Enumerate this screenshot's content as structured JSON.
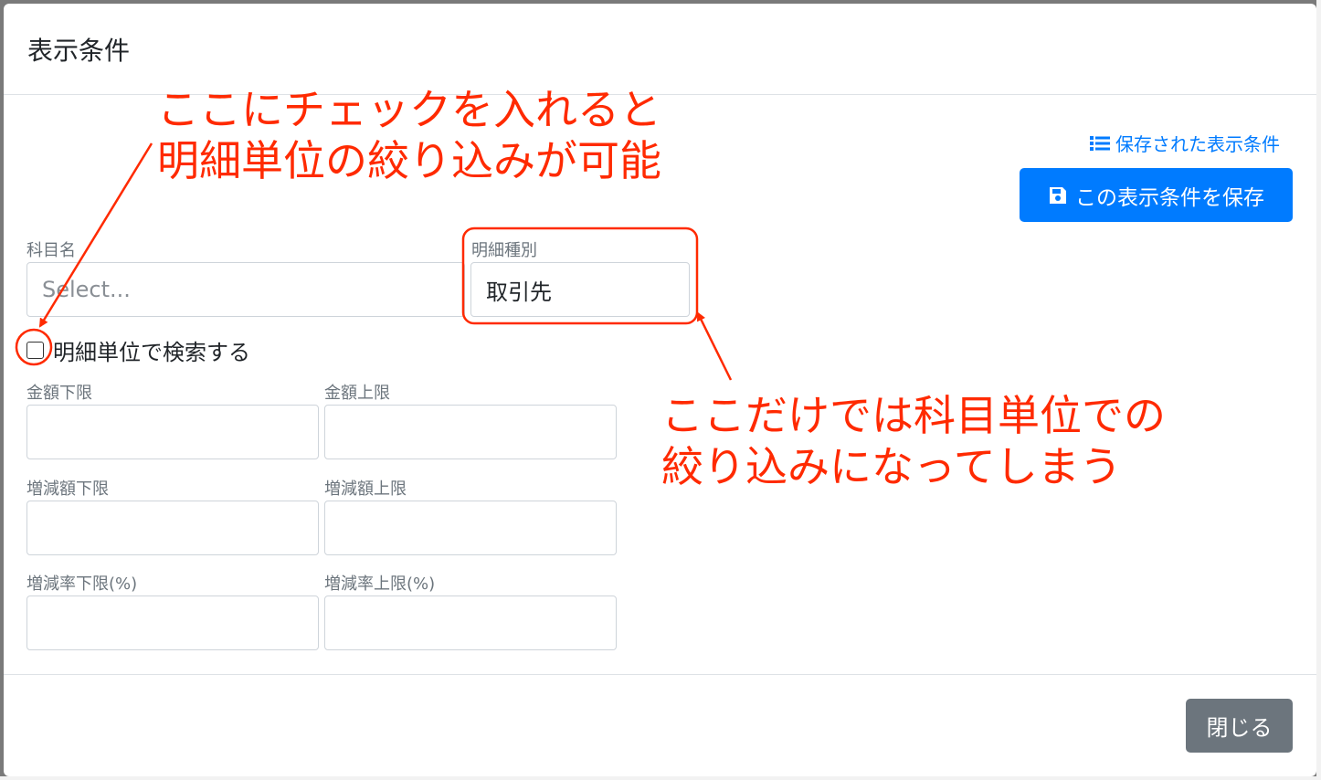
{
  "modal": {
    "title": "表示条件",
    "saved_conditions_link": "保存された表示条件",
    "save_button": "この表示条件を保存",
    "close_button": "閉じる"
  },
  "form": {
    "account_name": {
      "label": "科目名",
      "placeholder": "Select..."
    },
    "detail_type": {
      "label": "明細種別",
      "value": "取引先"
    },
    "detail_search_checkbox": {
      "label": "明細単位で検索する",
      "checked": false
    },
    "amount_min": {
      "label": "金額下限",
      "value": ""
    },
    "amount_max": {
      "label": "金額上限",
      "value": ""
    },
    "change_amount_min": {
      "label": "増減額下限",
      "value": ""
    },
    "change_amount_max": {
      "label": "増減額上限",
      "value": ""
    },
    "change_rate_min": {
      "label": "増減率下限(%)",
      "value": ""
    },
    "change_rate_max": {
      "label": "増減率上限(%)",
      "value": ""
    }
  },
  "annotations": {
    "top_line1": "ここにチェックを入れると",
    "top_line2": "明細単位の絞り込みが可能",
    "right_line1": "ここだけでは科目単位での",
    "right_line2": "絞り込みになってしまう"
  },
  "colors": {
    "primary": "#007bff",
    "secondary": "#6c757d",
    "annotation": "#ff2a00"
  },
  "icons": {
    "saved_link_icon": "list-icon",
    "save_button_icon": "floppy-disk-icon"
  }
}
